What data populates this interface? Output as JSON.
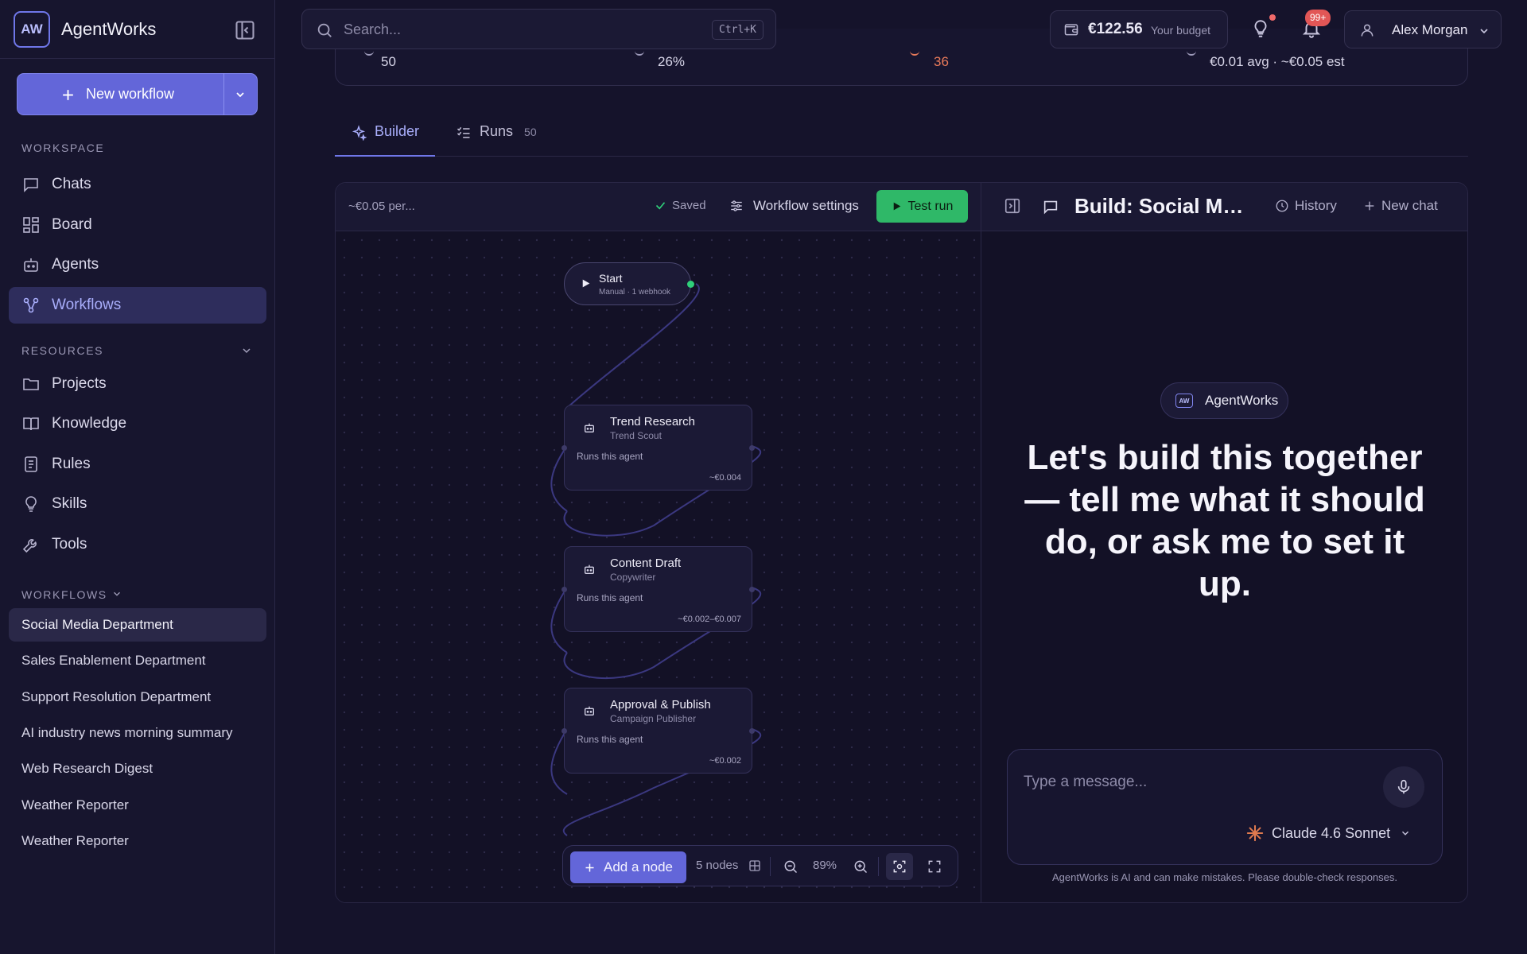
{
  "app": {
    "logo_text": "AW",
    "name": "AgentWorks"
  },
  "sidebar": {
    "new_workflow_label": "New workflow",
    "workspace_label": "WORKSPACE",
    "workspace_items": [
      {
        "label": "Chats",
        "icon": "chat-icon"
      },
      {
        "label": "Board",
        "icon": "board-icon"
      },
      {
        "label": "Agents",
        "icon": "agent-icon"
      },
      {
        "label": "Workflows",
        "icon": "workflow-icon",
        "active": true
      }
    ],
    "resources_label": "RESOURCES",
    "resource_items": [
      {
        "label": "Projects",
        "icon": "folder-icon"
      },
      {
        "label": "Knowledge",
        "icon": "book-icon"
      },
      {
        "label": "Rules",
        "icon": "rules-icon"
      },
      {
        "label": "Skills",
        "icon": "bulb-icon"
      },
      {
        "label": "Tools",
        "icon": "wrench-icon"
      }
    ],
    "workflows_label": "WORKFLOWS",
    "workflow_items": [
      {
        "label": "Social Media Department",
        "active": true
      },
      {
        "label": "Sales Enablement Department"
      },
      {
        "label": "Support Resolution Department"
      },
      {
        "label": "AI industry news morning summary"
      },
      {
        "label": "Web Research Digest"
      },
      {
        "label": "Weather Reporter"
      },
      {
        "label": "Weather Reporter"
      }
    ]
  },
  "topbar": {
    "search_placeholder": "Search...",
    "search_shortcut": "Ctrl+K",
    "budget_amount": "€122.56",
    "budget_label": "Your budget",
    "notification_count": "99+",
    "user_name": "Alex Morgan"
  },
  "stats": {
    "runs": "50",
    "rate": "26%",
    "errors": "36",
    "cost": "€0.01 avg · ~€0.05 est"
  },
  "tabs": [
    {
      "label": "Builder",
      "active": true
    },
    {
      "label": "Runs",
      "count": "50"
    }
  ],
  "builder": {
    "cost_per": "~€0.05 per...",
    "saved_label": "Saved",
    "settings_label": "Workflow settings",
    "test_run_label": "Test run",
    "start_node": {
      "title": "Start",
      "subtitle": "Manual · 1 webhook"
    },
    "nodes": [
      {
        "title": "Trend Research",
        "agent": "Trend Scout",
        "runs_label": "Runs this agent",
        "cost": "~€0.004"
      },
      {
        "title": "Content Draft",
        "agent": "Copywriter",
        "runs_label": "Runs this agent",
        "cost": "~€0.002–€0.007"
      },
      {
        "title": "Approval & Publish",
        "agent": "Campaign Publisher",
        "runs_label": "Runs this agent",
        "cost": "~€0.002"
      }
    ],
    "add_node_label": "Add a node",
    "node_count": "5 nodes",
    "zoom": "89%"
  },
  "chat": {
    "title": "Build: Social Media...",
    "history_label": "History",
    "new_chat_label": "New chat",
    "brand_pill": "AgentWorks",
    "brand_mini": "AW",
    "hero": "Let's build this together — tell me what it should do, or ask me to set it up.",
    "input_placeholder": "Type a message...",
    "model": "Claude 4.6 Sonnet",
    "disclaimer": "AgentWorks is AI and can make mistakes. Please double-check responses."
  },
  "colors": {
    "accent": "#6366d9",
    "success": "#2fb868",
    "danger": "#e25656",
    "background": "#15132b"
  }
}
